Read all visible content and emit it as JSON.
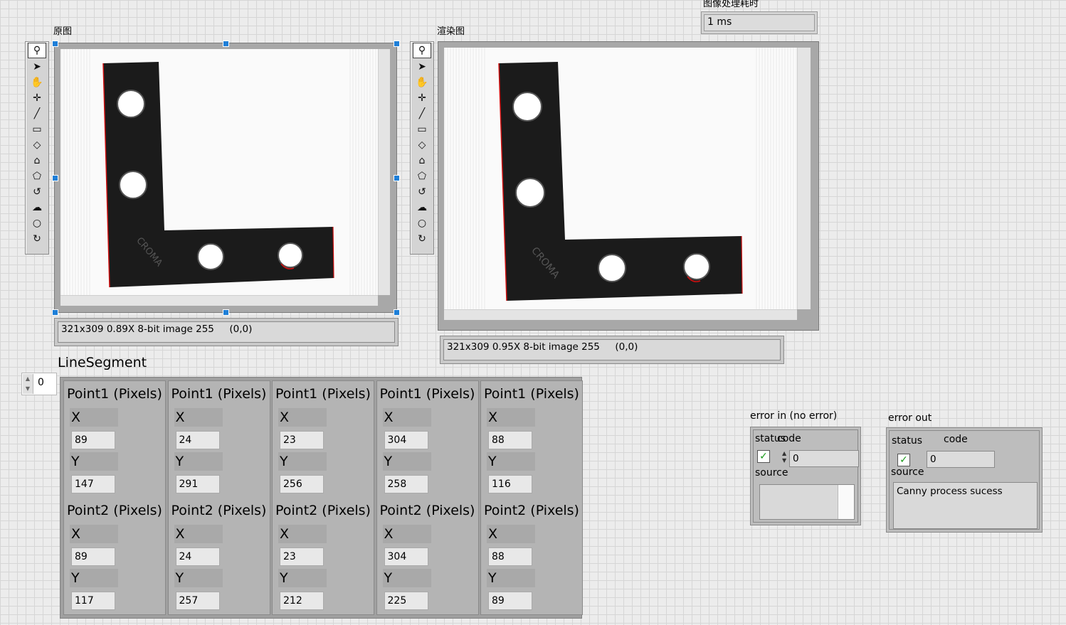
{
  "original": {
    "label": "原图",
    "status": "321x309 0.89X 8-bit image 255     (0,0)"
  },
  "rendered": {
    "label": "渲染图",
    "status": "321x309 0.95X 8-bit image 255     (0,0)"
  },
  "timing": {
    "label": "图像处理耗时",
    "value": "1 ms"
  },
  "palette_tools": [
    "zoom-icon",
    "pointer-icon",
    "pan-hand-icon",
    "point-icon",
    "line-icon",
    "rectangle-icon",
    "rotated-rectangle-icon",
    "annulus-icon",
    "polygon-icon",
    "freehand-icon",
    "freehand-region-icon",
    "oval-icon",
    "broken-line-icon"
  ],
  "line_segment": {
    "label": "LineSegment",
    "index": "0",
    "point1_label": "Point1 (Pixels)",
    "point2_label": "Point2 (Pixels)",
    "x_label": "X",
    "y_label": "Y",
    "items": [
      {
        "p1x": "89",
        "p1y": "147",
        "p2x": "89",
        "p2y": "117"
      },
      {
        "p1x": "24",
        "p1y": "291",
        "p2x": "24",
        "p2y": "257"
      },
      {
        "p1x": "23",
        "p1y": "256",
        "p2x": "23",
        "p2y": "212"
      },
      {
        "p1x": "304",
        "p1y": "258",
        "p2x": "304",
        "p2y": "225"
      },
      {
        "p1x": "88",
        "p1y": "116",
        "p2x": "88",
        "p2y": "89"
      }
    ]
  },
  "error_in": {
    "label": "error in (no error)",
    "status_label": "status",
    "code_label": "code",
    "code_value": "0",
    "source_label": "source",
    "source_value": ""
  },
  "error_out": {
    "label": "error out",
    "status_label": "status",
    "code_label": "code",
    "code_value": "0",
    "source_label": "source",
    "source_value": "Canny process sucess"
  },
  "colors": {
    "status_check": "#1a9a1a",
    "selection_handle": "#1e7fd8",
    "part": "#1b1b1b",
    "edge_highlight": "#d01010"
  }
}
